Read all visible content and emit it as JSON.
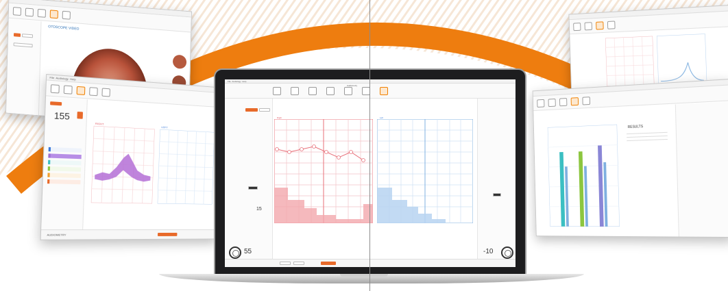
{
  "colors": {
    "accent_orange": "#f08000",
    "left_ear_red": "#e8707a",
    "right_ear_blue": "#7fb0e0",
    "bar_teal": "#3bbfc2",
    "bar_green": "#8cc63f",
    "bar_purple": "#8a86d6"
  },
  "windows": {
    "otoscope": {
      "tab_label": "OTOSCOPE VIDEO"
    },
    "speech": {
      "menu": [
        "File",
        "Audiology",
        "Help"
      ],
      "level_value": "155",
      "left_chart_label": "RIGHT",
      "right_chart_label": "LEFT",
      "footer_label": "AUDIOMETRY"
    },
    "main": {
      "menu": [
        "File",
        "Audiology",
        "Help"
      ],
      "active_tab": "Audiometry",
      "left_chart_label": "Right",
      "right_chart_label": "Left",
      "level_left": "55",
      "level_right": "-10",
      "step_value": "15"
    },
    "results": {
      "heading": "RESULTS"
    }
  },
  "icons": {
    "knob_left": "dial-knob-icon",
    "knob_right": "dial-knob-icon"
  }
}
